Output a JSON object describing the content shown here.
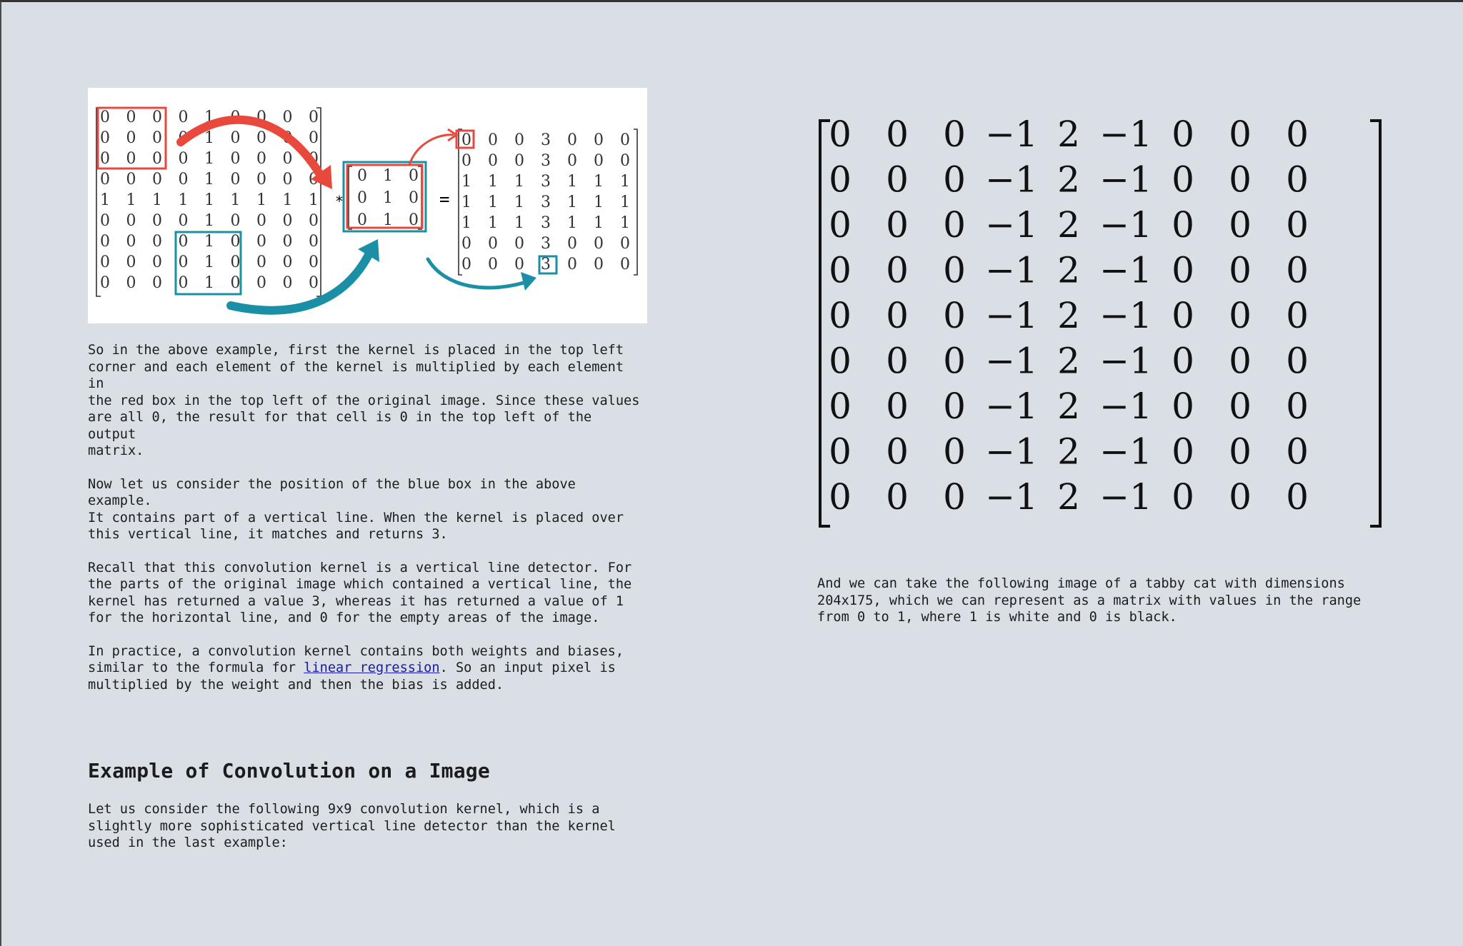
{
  "figure": {
    "input_matrix": [
      [
        "0",
        "0",
        "0",
        "0",
        "1",
        "0",
        "0",
        "0",
        "0"
      ],
      [
        "0",
        "0",
        "0",
        "0",
        "1",
        "0",
        "0",
        "0",
        "0"
      ],
      [
        "0",
        "0",
        "0",
        "0",
        "1",
        "0",
        "0",
        "0",
        "0"
      ],
      [
        "0",
        "0",
        "0",
        "0",
        "1",
        "0",
        "0",
        "0",
        "0"
      ],
      [
        "1",
        "1",
        "1",
        "1",
        "1",
        "1",
        "1",
        "1",
        "1"
      ],
      [
        "0",
        "0",
        "0",
        "0",
        "1",
        "0",
        "0",
        "0",
        "0"
      ],
      [
        "0",
        "0",
        "0",
        "0",
        "1",
        "0",
        "0",
        "0",
        "0"
      ],
      [
        "0",
        "0",
        "0",
        "0",
        "1",
        "0",
        "0",
        "0",
        "0"
      ],
      [
        "0",
        "0",
        "0",
        "0",
        "1",
        "0",
        "0",
        "0",
        "0"
      ]
    ],
    "kernel_matrix": [
      [
        "0",
        "1",
        "0"
      ],
      [
        "0",
        "1",
        "0"
      ],
      [
        "0",
        "1",
        "0"
      ]
    ],
    "output_matrix": [
      [
        "0",
        "0",
        "0",
        "3",
        "0",
        "0",
        "0"
      ],
      [
        "0",
        "0",
        "0",
        "3",
        "0",
        "0",
        "0"
      ],
      [
        "1",
        "1",
        "1",
        "3",
        "1",
        "1",
        "1"
      ],
      [
        "1",
        "1",
        "1",
        "3",
        "1",
        "1",
        "1"
      ],
      [
        "1",
        "1",
        "1",
        "3",
        "1",
        "1",
        "1"
      ],
      [
        "0",
        "0",
        "0",
        "3",
        "0",
        "0",
        "0"
      ],
      [
        "0",
        "0",
        "0",
        "3",
        "0",
        "0",
        "0"
      ]
    ],
    "operator_convolve": "*",
    "operator_equals": "=",
    "colors": {
      "red": "#e8493c",
      "teal": "#1a8fa6"
    }
  },
  "left": {
    "para1": "So in the above example, first the kernel is placed in the top left\ncorner and each element of the kernel is multiplied by each element in\nthe red box in the top left of the original image. Since these values\nare all 0, the result for that cell is 0 in the top left of the output\nmatrix.",
    "para2": "Now let us consider the position of the blue box in the above example.\nIt contains part of a vertical line. When the kernel is placed over\nthis vertical line, it matches and returns 3.",
    "para3": "Recall that this convolution kernel is a vertical line detector. For\nthe parts of the original image which contained a vertical line, the\nkernel has returned a value 3, whereas it has returned a value of 1\nfor the horizontal line, and 0 for the empty areas of the image.",
    "para4_before": "In practice, a convolution kernel contains both weights and biases,\nsimilar to the formula for ",
    "para4_link": "linear regression",
    "para4_after": ". So an input pixel is\nmultiplied by the weight and then the bias is added.",
    "heading": "Example of Convolution on a Image",
    "para5": "Let us consider the following 9x9 convolution kernel, which is a\nslightly more sophisticated vertical line detector than the kernel\nused in the last example:"
  },
  "right": {
    "kernel_9x9": [
      [
        "0",
        "0",
        "0",
        "−1",
        "2",
        "−1",
        "0",
        "0",
        "0"
      ],
      [
        "0",
        "0",
        "0",
        "−1",
        "2",
        "−1",
        "0",
        "0",
        "0"
      ],
      [
        "0",
        "0",
        "0",
        "−1",
        "2",
        "−1",
        "0",
        "0",
        "0"
      ],
      [
        "0",
        "0",
        "0",
        "−1",
        "2",
        "−1",
        "0",
        "0",
        "0"
      ],
      [
        "0",
        "0",
        "0",
        "−1",
        "2",
        "−1",
        "0",
        "0",
        "0"
      ],
      [
        "0",
        "0",
        "0",
        "−1",
        "2",
        "−1",
        "0",
        "0",
        "0"
      ],
      [
        "0",
        "0",
        "0",
        "−1",
        "2",
        "−1",
        "0",
        "0",
        "0"
      ],
      [
        "0",
        "0",
        "0",
        "−1",
        "2",
        "−1",
        "0",
        "0",
        "0"
      ],
      [
        "0",
        "0",
        "0",
        "−1",
        "2",
        "−1",
        "0",
        "0",
        "0"
      ]
    ],
    "para": "And we can take the following image of a tabby cat with dimensions\n204x175, which we can represent as a matrix with values in the range\nfrom 0 to 1, where 1 is white and 0 is black."
  }
}
